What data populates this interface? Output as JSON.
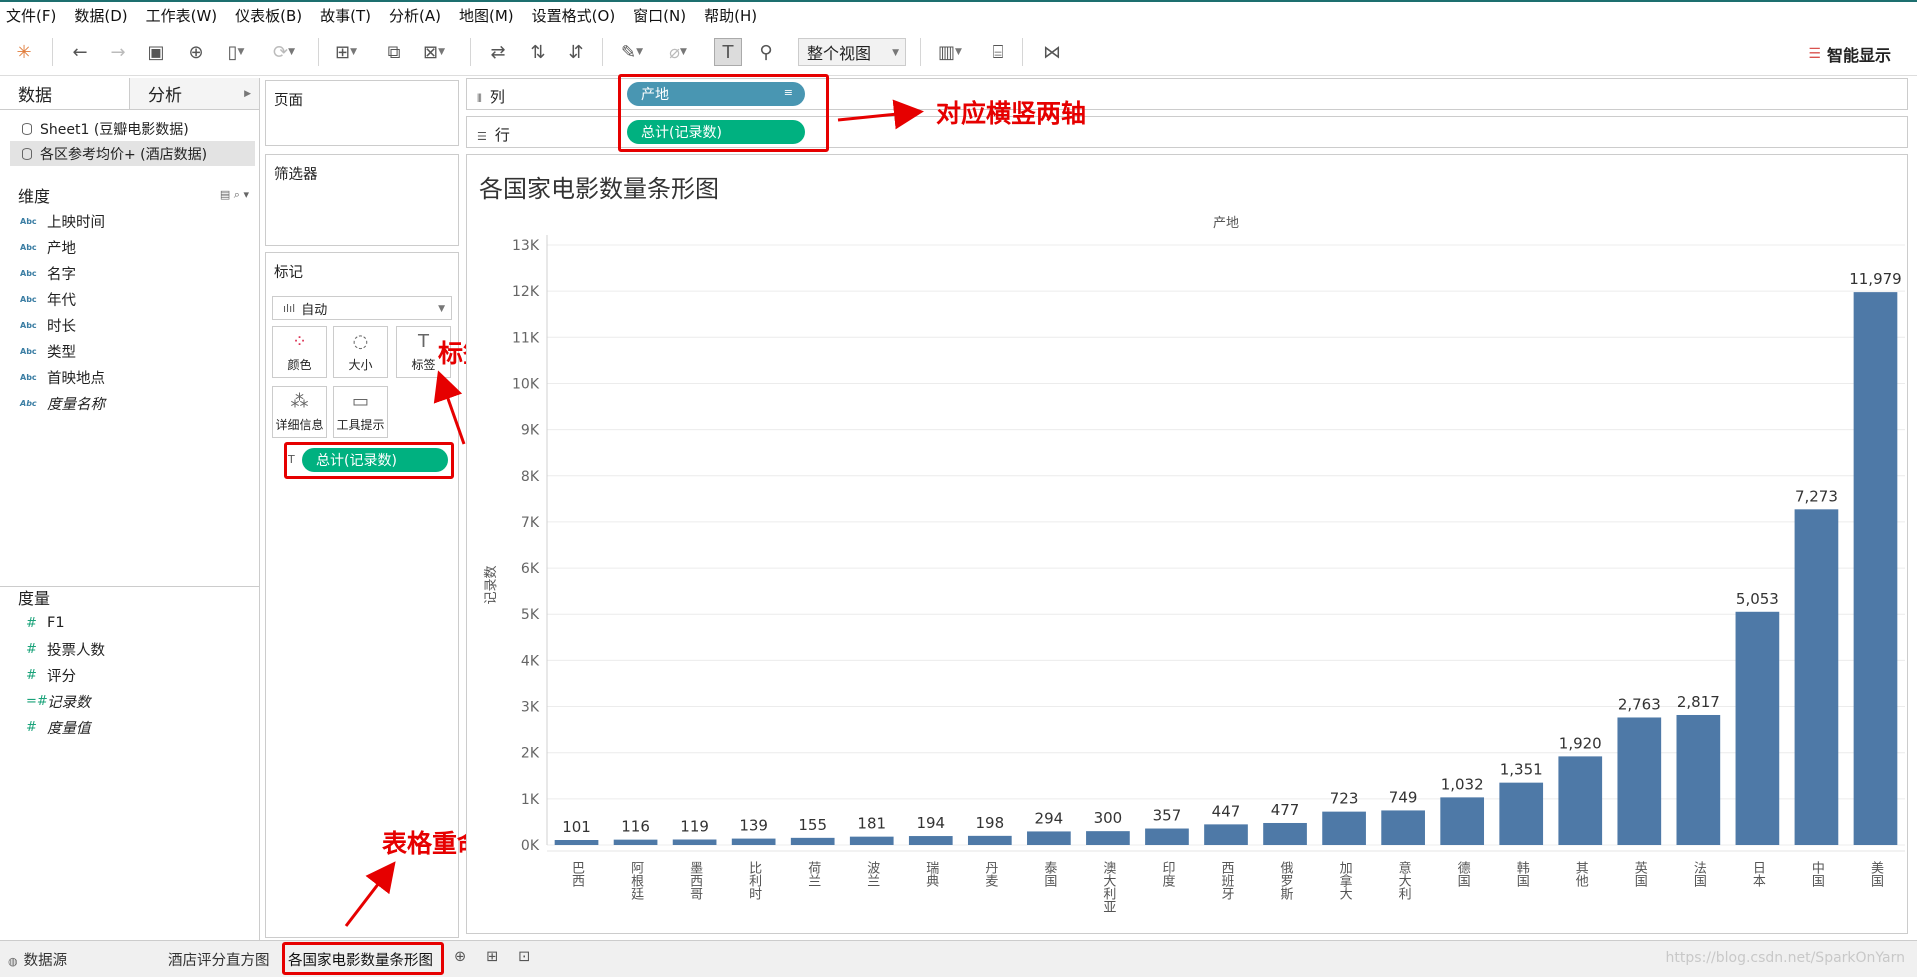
{
  "menu": [
    "文件(F)",
    "数据(D)",
    "工作表(W)",
    "仪表板(B)",
    "故事(T)",
    "分析(A)",
    "地图(M)",
    "设置格式(O)",
    "窗口(N)",
    "帮助(H)"
  ],
  "toolbar": {
    "view_select": "整个视图",
    "show_me": "智能显示"
  },
  "data_pane": {
    "tabs": [
      "数据",
      "分析"
    ],
    "sources": [
      "Sheet1 (豆瓣电影数据)",
      "各区参考均价+ (酒店数据)"
    ],
    "dimensions_title": "维度",
    "dimensions": [
      "上映时间",
      "产地",
      "名字",
      "年代",
      "时长",
      "类型",
      "首映地点",
      "度量名称"
    ],
    "measures_title": "度量",
    "measures": [
      "F1",
      "投票人数",
      "评分",
      "记录数",
      "度量值"
    ]
  },
  "cards": {
    "pages": "页面",
    "filters": "筛选器",
    "marks": "标记",
    "mark_type": "自动",
    "mark_buttons": [
      "颜色",
      "大小",
      "标签",
      "详细信息",
      "工具提示"
    ],
    "marks_pill": "总计(记录数)"
  },
  "shelves": {
    "columns_label": "列",
    "rows_label": "行",
    "columns_pill": "产地",
    "rows_pill": "总计(记录数)"
  },
  "annotations": {
    "axes": "对应横竖两轴",
    "label": "标签数字显示",
    "rename": "表格重命名"
  },
  "bottom_tabs": [
    "数据源",
    "酒店评分直方图",
    "各国家电影数量条形图"
  ],
  "watermark": "https://blog.csdn.net/SparkOnYarn",
  "chart_data": {
    "type": "bar",
    "title": "各国家电影数量条形图",
    "xlabel": "产地",
    "ylabel": "记录数",
    "categories": [
      "巴西",
      "阿根廷",
      "墨西哥",
      "比利时",
      "荷兰",
      "波兰",
      "瑞典",
      "丹麦",
      "泰国",
      "澳大利亚",
      "印度",
      "西班牙",
      "俄罗斯",
      "加拿大",
      "意大利",
      "德国",
      "韩国",
      "其他",
      "英国",
      "法国",
      "日本",
      "中国",
      "美国"
    ],
    "values": [
      101,
      116,
      119,
      139,
      155,
      181,
      194,
      198,
      294,
      300,
      357,
      447,
      477,
      723,
      749,
      1032,
      1351,
      1920,
      2763,
      2817,
      5053,
      7273,
      11979
    ],
    "value_labels": [
      "101",
      "116",
      "119",
      "139",
      "155",
      "181",
      "194",
      "198",
      "294",
      "300",
      "357",
      "447",
      "477",
      "723",
      "749",
      "1,032",
      "1,351",
      "1,920",
      "2,763",
      "2,817",
      "5,053",
      "7,273",
      "11,979"
    ],
    "yticks": [
      "0K",
      "1K",
      "2K",
      "3K",
      "4K",
      "5K",
      "6K",
      "7K",
      "8K",
      "9K",
      "10K",
      "11K",
      "12K",
      "13K"
    ],
    "ylim": [
      0,
      13000
    ],
    "grid": true,
    "color": "#4e79a7"
  }
}
